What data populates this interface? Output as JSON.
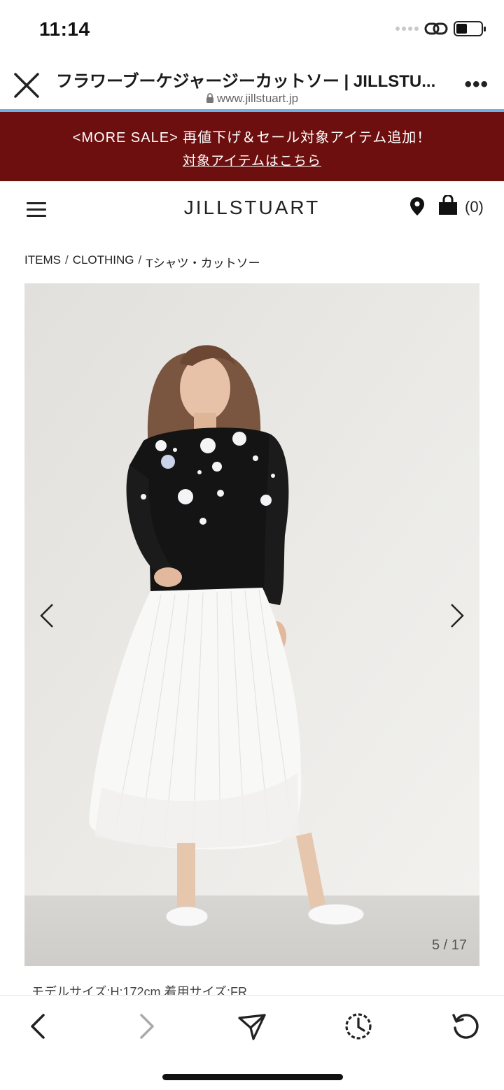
{
  "status_bar": {
    "time": "11:14"
  },
  "browser": {
    "page_title": "フラワーブーケジャージーカットソー | JILLSTU...",
    "url": "www.jillstuart.jp"
  },
  "sale_banner": {
    "line1": "<MORE SALE> 再値下げ＆セール対象アイテム追加！",
    "link": "対象アイテムはこちら",
    "background": "#6e0f0f"
  },
  "header": {
    "logo": "JILLSTUART",
    "cart_count": "(0)"
  },
  "breadcrumb": [
    "ITEMS",
    "CLOTHING",
    "Tシャツ・カットソー"
  ],
  "breadcrumb_separator": "/",
  "gallery": {
    "counter": "5 / 17",
    "current": 5,
    "total": 17
  },
  "model_info": "モデルサイズ:H:172cm 着用サイズ:FR",
  "toolbar_icons": [
    "back-icon",
    "forward-icon",
    "share-icon",
    "history-icon",
    "refresh-icon"
  ],
  "colors": {
    "accent_progress": "#6fb1e3",
    "banner": "#6e0f0f"
  }
}
